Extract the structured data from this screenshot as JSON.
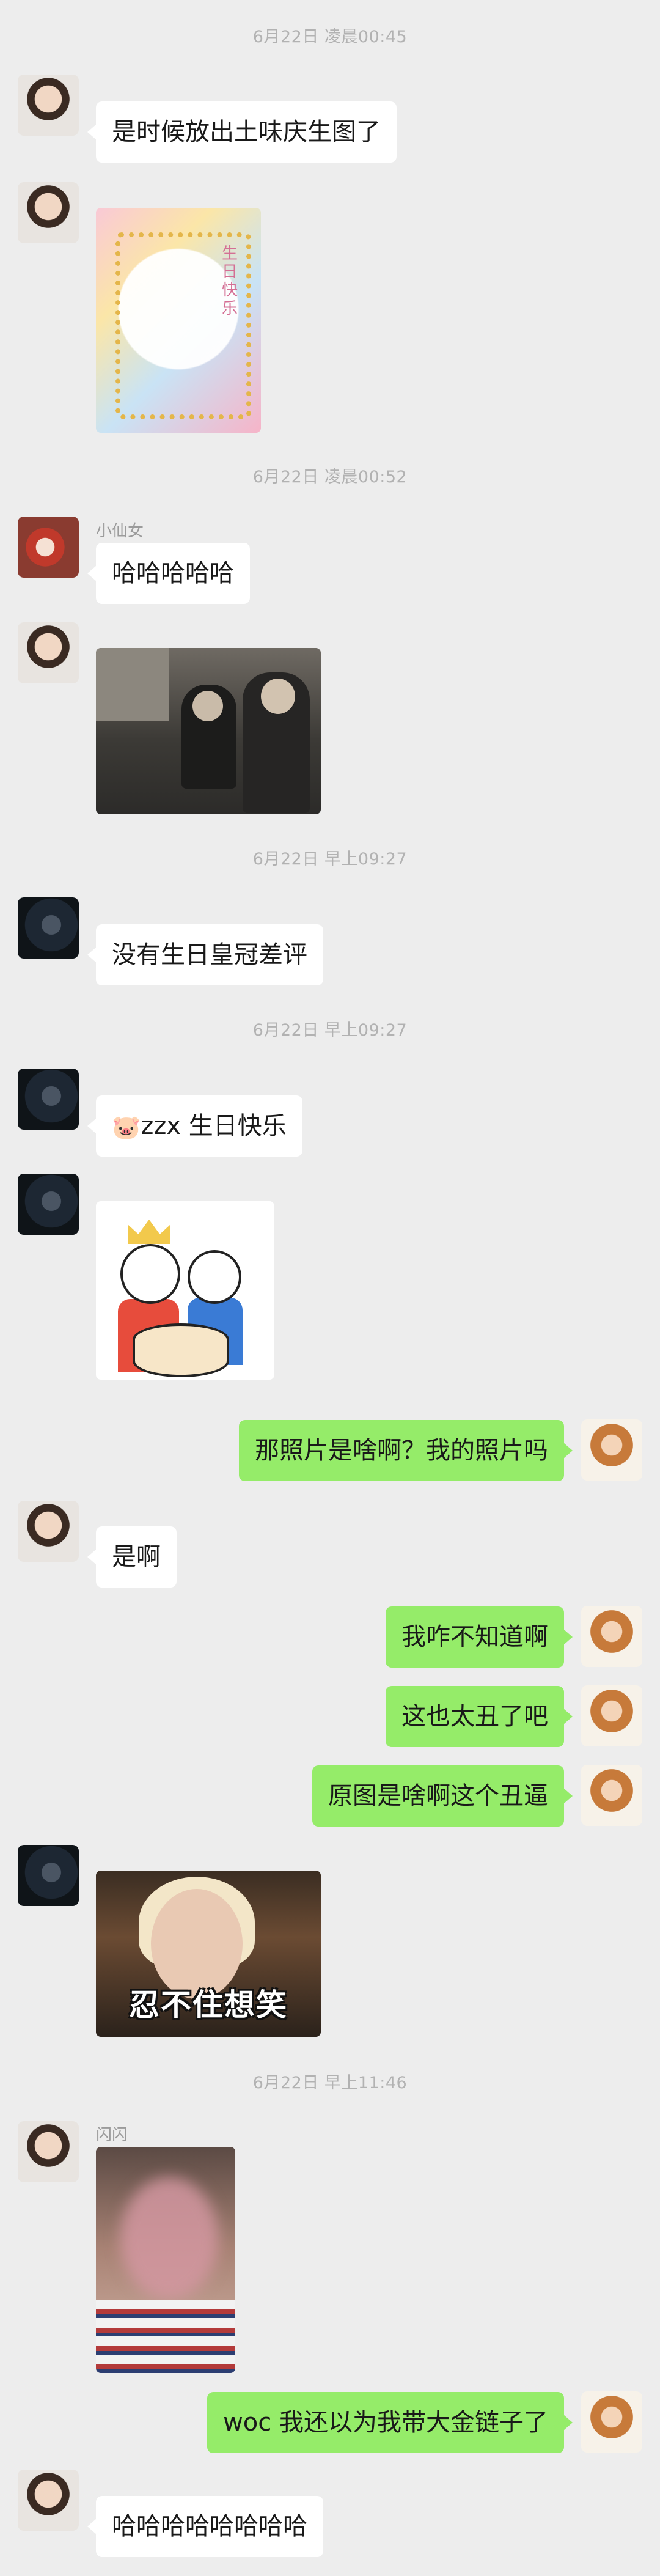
{
  "timestamps": [
    "6月22日 凌晨00:45",
    "6月22日 凌晨00:52",
    "6月22日 早上09:27",
    "6月22日 早上09:27",
    "6月22日 早上11:46"
  ],
  "nicknames": {
    "xiaoxiannv": "小仙女",
    "shanshan": "闪闪"
  },
  "messages": {
    "m1": "是时候放出土味庆生图了",
    "m2": "哈哈哈哈哈",
    "m3": "没有生日皇冠差评",
    "m4": "zzx 生日快乐",
    "m5": "那照片是啥啊？我的照片吗",
    "m6": "是啊",
    "m7": "我咋不知道啊",
    "m8": "这也太丑了吧",
    "m9": "原图是啥啊这个丑逼",
    "m10": "woc 我还以为我带大金链子了",
    "m11": "哈哈哈哈哈哈哈哈"
  },
  "images": {
    "card_text": "生日快乐",
    "meme_caption": "忍不住想笑"
  },
  "emoji": {
    "pig": "🐷"
  },
  "colors": {
    "bg": "#ededed",
    "my_bubble": "#95ec69",
    "their_bubble": "#ffffff",
    "timestamp": "#b2b2b2"
  }
}
